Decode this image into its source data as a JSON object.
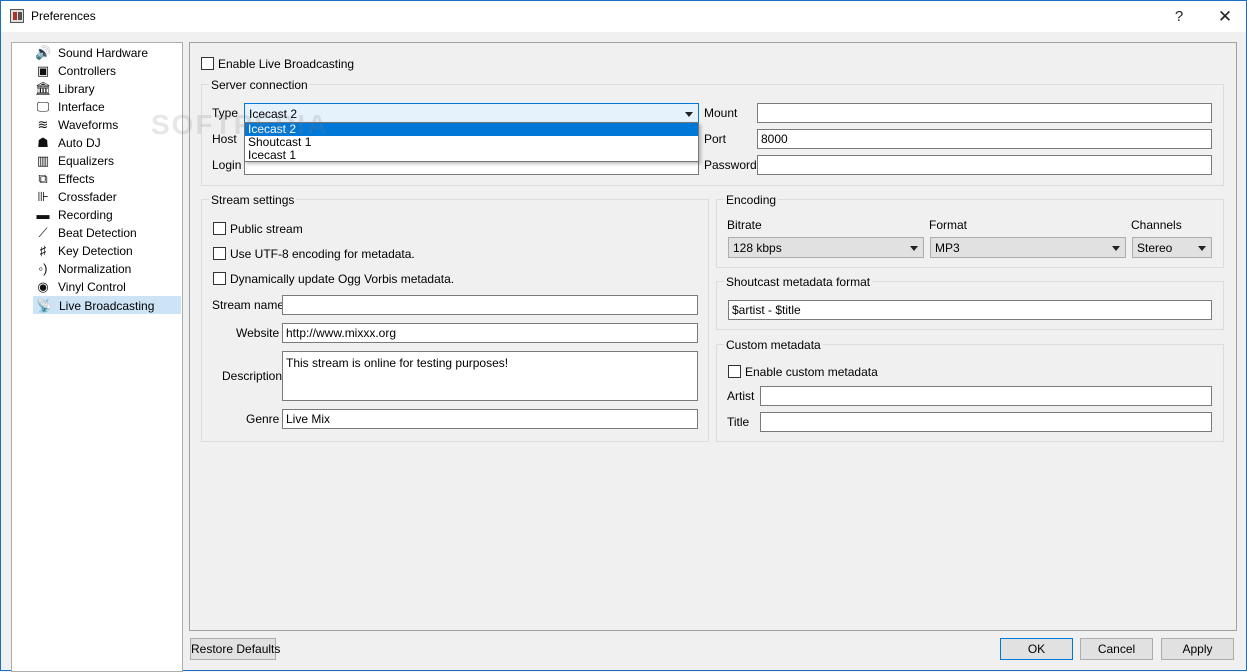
{
  "window": {
    "title": "Preferences",
    "help_label": "?",
    "close_label": "✕"
  },
  "sidebar": {
    "items": [
      {
        "label": "Sound Hardware",
        "icon": "speaker-icon"
      },
      {
        "label": "Controllers",
        "icon": "controller-icon"
      },
      {
        "label": "Library",
        "icon": "library-icon"
      },
      {
        "label": "Interface",
        "icon": "monitor-icon"
      },
      {
        "label": "Waveforms",
        "icon": "waveform-icon"
      },
      {
        "label": "Auto DJ",
        "icon": "robot-icon"
      },
      {
        "label": "Equalizers",
        "icon": "equalizer-icon"
      },
      {
        "label": "Effects",
        "icon": "effects-icon"
      },
      {
        "label": "Crossfader",
        "icon": "crossfader-icon"
      },
      {
        "label": "Recording",
        "icon": "recording-icon"
      },
      {
        "label": "Beat Detection",
        "icon": "beat-icon"
      },
      {
        "label": "Key Detection",
        "icon": "key-icon"
      },
      {
        "label": "Normalization",
        "icon": "normalization-icon"
      },
      {
        "label": "Vinyl Control",
        "icon": "vinyl-icon"
      },
      {
        "label": "Live Broadcasting",
        "icon": "broadcast-icon",
        "selected": true
      }
    ]
  },
  "main": {
    "enable_live_label": "Enable Live Broadcasting",
    "server": {
      "title": "Server connection",
      "type_label": "Type",
      "type_value": "Icecast 2",
      "type_options": [
        "Icecast 2",
        "Shoutcast 1",
        "Icecast 1"
      ],
      "host_label": "Host",
      "login_label": "Login",
      "mount_label": "Mount",
      "mount_value": "",
      "port_label": "Port",
      "port_value": "8000",
      "password_label": "Password",
      "password_value": ""
    },
    "stream": {
      "title": "Stream settings",
      "public_label": "Public stream",
      "utf8_label": "Use UTF-8 encoding for metadata.",
      "ogg_label": "Dynamically update Ogg Vorbis metadata.",
      "name_label": "Stream name",
      "name_value": "",
      "website_label": "Website",
      "website_value": "http://www.mixxx.org",
      "description_label": "Description",
      "description_value": "This stream is online for testing purposes!",
      "genre_label": "Genre",
      "genre_value": "Live Mix"
    },
    "encoding": {
      "title": "Encoding",
      "bitrate_label": "Bitrate",
      "bitrate_value": "128 kbps",
      "format_label": "Format",
      "format_value": "MP3",
      "channels_label": "Channels",
      "channels_value": "Stereo"
    },
    "shoutcast": {
      "title": "Shoutcast metadata format",
      "value": "$artist - $title"
    },
    "custom": {
      "title": "Custom metadata",
      "enable_label": "Enable custom metadata",
      "artist_label": "Artist",
      "artist_value": "",
      "title_label": "Title",
      "title_value": ""
    }
  },
  "footer": {
    "restore_label": "Restore Defaults",
    "ok_label": "OK",
    "cancel_label": "Cancel",
    "apply_label": "Apply"
  },
  "watermark": "SOFTPEDIA",
  "colors": {
    "accent": "#0078d7",
    "selected_bg": "#cde4f7",
    "window_border": "#1a6fc4"
  }
}
